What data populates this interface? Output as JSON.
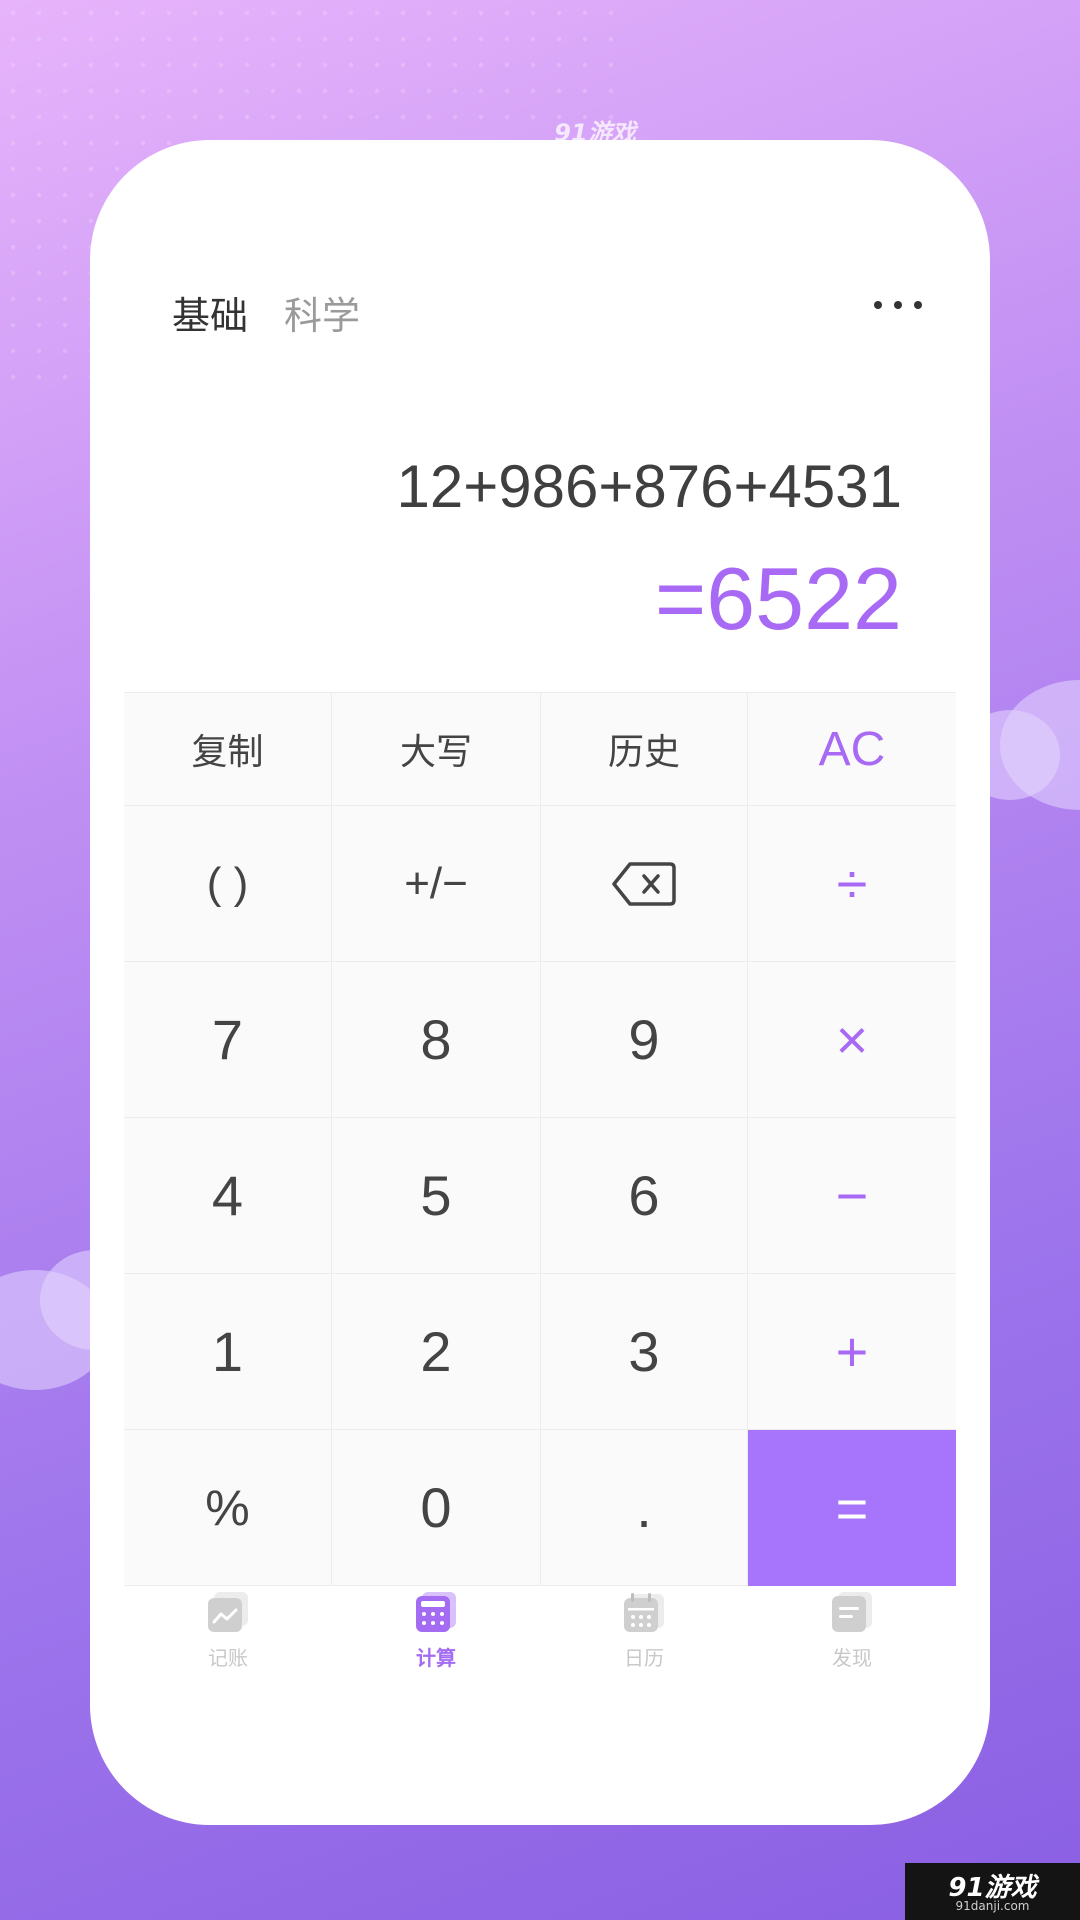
{
  "brand": {
    "top_logo": "91游戏",
    "watermark_main": "91游戏",
    "watermark_sub": "91danji.com"
  },
  "tabs": [
    {
      "label": "基础",
      "active": true
    },
    {
      "label": "科学",
      "active": false
    }
  ],
  "menu": {
    "icon": "more-horizontal-icon"
  },
  "display": {
    "expression": "12+986+876+4531",
    "result": "=6522"
  },
  "keys": {
    "row1": [
      "复制",
      "大写",
      "历史",
      "AC"
    ],
    "row2": [
      "( )",
      "+/−",
      "backspace-icon",
      "÷"
    ],
    "row3": [
      "7",
      "8",
      "9",
      "×"
    ],
    "row4": [
      "4",
      "5",
      "6",
      "−"
    ],
    "row5": [
      "1",
      "2",
      "3",
      "+"
    ],
    "row6": [
      "%",
      "0",
      ".",
      "="
    ]
  },
  "nav": [
    {
      "label": "记账",
      "icon": "ledger-icon",
      "active": false
    },
    {
      "label": "计算",
      "icon": "calculator-icon",
      "active": true
    },
    {
      "label": "日历",
      "icon": "calendar-icon",
      "active": false
    },
    {
      "label": "发现",
      "icon": "discover-icon",
      "active": false
    }
  ],
  "colors": {
    "accent": "#a86af5",
    "equals_bg": "#a675fb",
    "text": "#444444",
    "muted": "#9a9a9a",
    "nav_inactive": "#c8c8c8"
  }
}
